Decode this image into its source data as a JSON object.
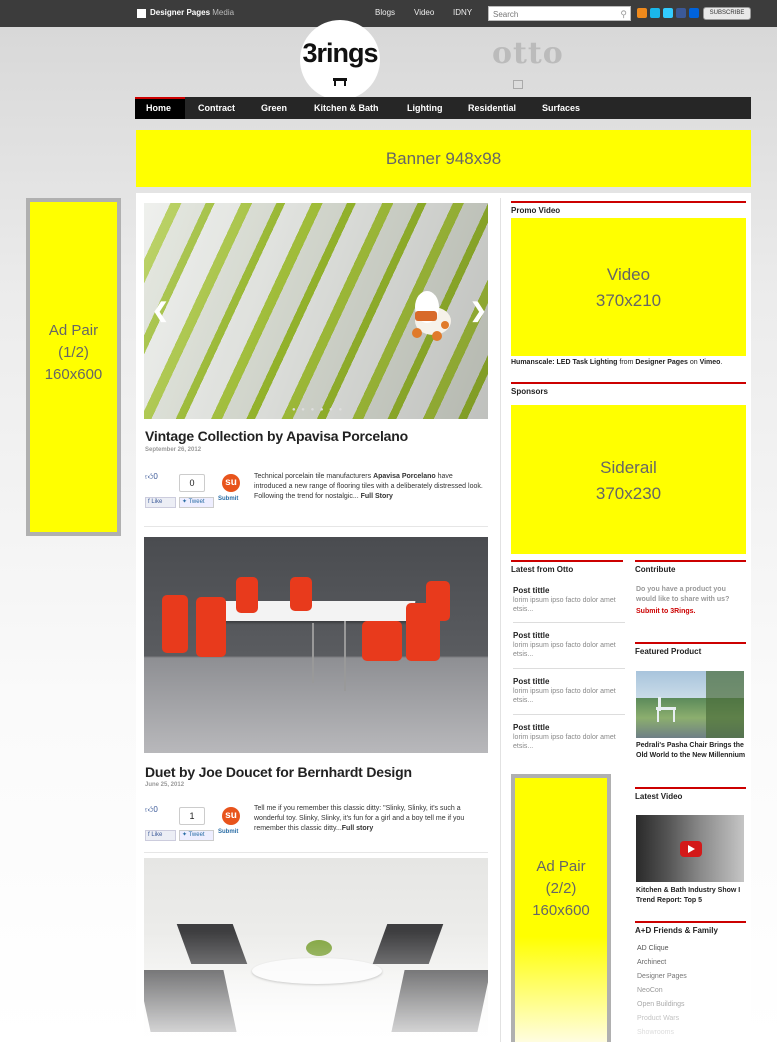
{
  "topbar": {
    "brand": "Designer Pages",
    "brand_sub": "Media",
    "nav": [
      "Blogs",
      "Video",
      "IDNY"
    ],
    "search_placeholder": "Search",
    "subscribe": "SUBSCRIBE"
  },
  "logos": {
    "left": "3rings",
    "right": "otto"
  },
  "mainnav": [
    "Home",
    "Contract",
    "Green",
    "Kitchen & Bath",
    "Lighting",
    "Residential",
    "Surfaces"
  ],
  "banner": "Banner 948x98",
  "ad_left": [
    "Ad Pair",
    "(1/2)",
    "160x600"
  ],
  "ad_right": [
    "Ad Pair",
    "(2/2)",
    "160x600"
  ],
  "posts": [
    {
      "title": "Vintage Collection by Apavisa Porcelano",
      "date": "September 26, 2012",
      "like_count": "0",
      "count": "0",
      "like": "Like",
      "tweet": "Tweet",
      "submit": "Submit",
      "excerpt_a": "Technical porcelain tile manufacturers ",
      "excerpt_bold": "Apavisa Porcelano",
      "excerpt_b": " have introduced a new range of flooring tiles with a deliberately distressed look. Following the trend for nostalgic... ",
      "more": "Full Story"
    },
    {
      "title": "Duet by Joe Doucet for Bernhardt Design",
      "date": "June 25, 2012",
      "like_count": "0",
      "count": "1",
      "like": "Like",
      "tweet": "Tweet",
      "submit": "Submit",
      "excerpt_a": "Tell me if you remember this classic ditty: \"Slinky, Slinky, it's such a wonderful toy. Slinky, Slinky, it's fun for a girl and a boy tell me if you remember this classic ditty...",
      "excerpt_bold": "",
      "excerpt_b": "",
      "more": "Full story"
    }
  ],
  "sidebar": {
    "promo_video_heading": "Promo Video",
    "video_box": [
      "Video",
      "370x210"
    ],
    "video_caption_a": "Humanscale: LED Task Lighting",
    "video_caption_b": " from ",
    "video_caption_c": "Designer Pages",
    "video_caption_d": " on ",
    "video_caption_e": "Vimeo",
    "video_caption_f": ".",
    "sponsors_heading": "Sponsors",
    "siderail_box": [
      "Siderail",
      "370x230"
    ],
    "latest_heading": "Latest from Otto",
    "latest": [
      {
        "title": "Post tittle",
        "body": "lorim ipsum ipso facto dolor amet etsis..."
      },
      {
        "title": "Post tittle",
        "body": "lorim ipsum ipso facto dolor amet etsis..."
      },
      {
        "title": "Post tittle",
        "body": "lorim ipsum ipso facto dolor amet etsis..."
      },
      {
        "title": "Post tittle",
        "body": "lorim ipsum ipso facto dolor amet etsis..."
      }
    ],
    "contribute_heading": "Contribute",
    "contribute_text": "Do you have a product you would like to share with us?",
    "contribute_link": "Submit to 3Rings.",
    "featured_heading": "Featured Product",
    "featured_caption": "Pedrali's Pasha Chair Brings the Old World to the New Millennium",
    "latest_video_heading": "Latest Video",
    "latest_video_caption": "Kitchen & Bath Industry Show I Trend Report: Top 5",
    "friends_heading": "A+D Friends & Family",
    "friends": [
      "AD Clique",
      "Archinect",
      "Designer Pages",
      "NeoCon",
      "Open Buildings",
      "Product Wars",
      "Showrooms"
    ]
  },
  "colors": {
    "accent": "#cc0000",
    "placeholder_yellow": "#ffff00",
    "nav_bg": "#262626"
  }
}
